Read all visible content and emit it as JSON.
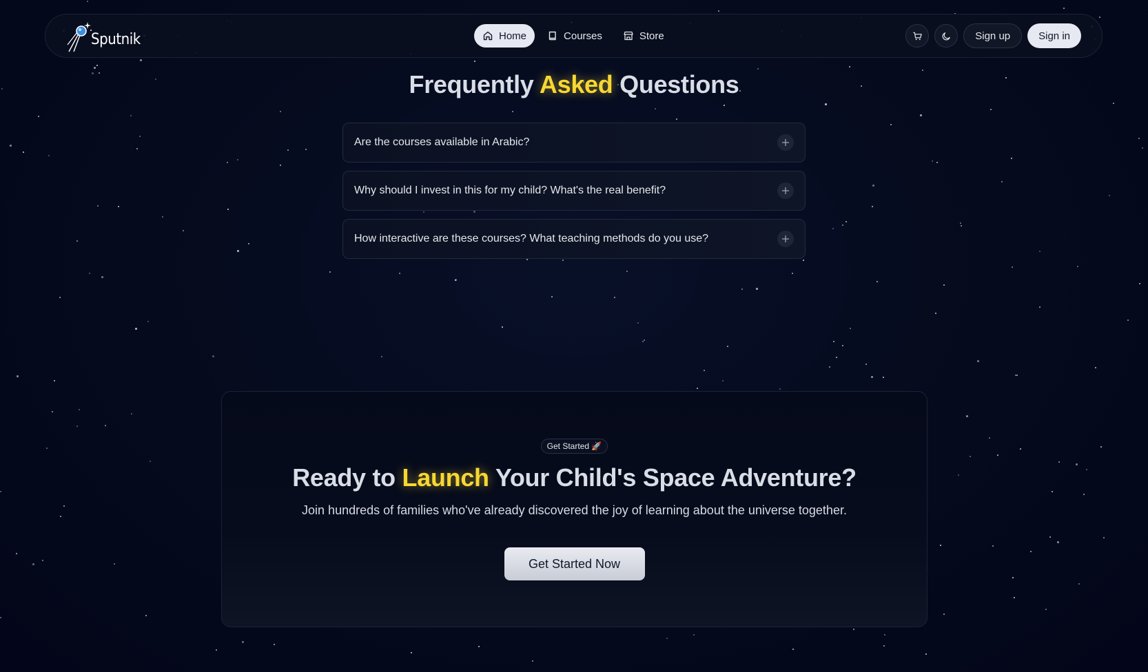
{
  "nav": {
    "brand": "Sputnik",
    "links": [
      {
        "label": "Home",
        "icon": "home-icon",
        "active": true
      },
      {
        "label": "Courses",
        "icon": "book-icon",
        "active": false
      },
      {
        "label": "Store",
        "icon": "store-icon",
        "active": false
      }
    ],
    "cart_icon": "cart-icon",
    "theme_icon": "moon-icon",
    "sign_up": "Sign up",
    "sign_in": "Sign in"
  },
  "faq": {
    "title_pre": "Frequently",
    "title_highlight": "Asked",
    "title_post": "Questions",
    "items": [
      {
        "question": "Are the courses available in Arabic?"
      },
      {
        "question": "Why should I invest in this for my child? What's the real benefit?"
      },
      {
        "question": "How interactive are these courses? What teaching methods do you use?"
      }
    ]
  },
  "cta": {
    "badge": "Get Started 🚀",
    "title_pre": "Ready to",
    "title_highlight": "Launch",
    "title_post": "Your Child's Space Adventure?",
    "subtitle": "Join hundreds of families who've already discovered the joy of learning about the universe together.",
    "button": "Get Started Now"
  },
  "colors": {
    "background": "#040818",
    "accent": "#f7d733",
    "text": "#e5e7eb"
  }
}
